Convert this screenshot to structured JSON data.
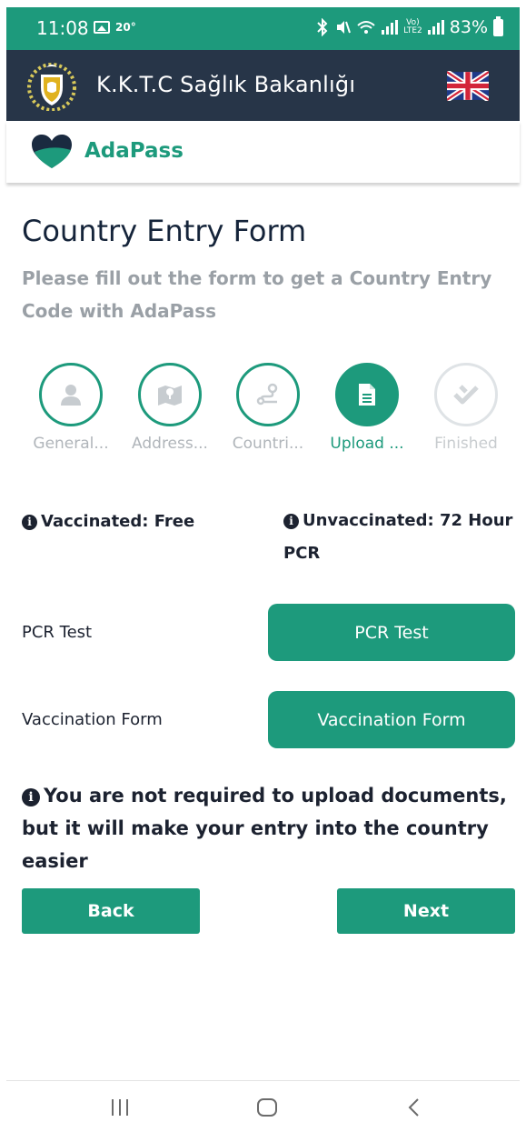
{
  "status_bar": {
    "time": "11:08",
    "temperature": "20°",
    "battery": "83%"
  },
  "header": {
    "title": "K.K.T.C Sağlık Bakanlığı",
    "emblem_icon": "kktc-emblem-icon",
    "language_icon": "uk-flag-icon"
  },
  "brand": {
    "name": "AdaPass",
    "logo_icon": "heart-logo-icon"
  },
  "page": {
    "title": "Country Entry Form",
    "subtitle": "Please fill out the form to get a Country Entry Code with AdaPass"
  },
  "steps": [
    {
      "label": "General...",
      "icon": "user-icon",
      "state": "complete"
    },
    {
      "label": "Address...",
      "icon": "map-icon",
      "state": "complete"
    },
    {
      "label": "Countri...",
      "icon": "route-icon",
      "state": "complete"
    },
    {
      "label": "Upload ...",
      "icon": "document-icon",
      "state": "active"
    },
    {
      "label": "Finished",
      "icon": "check-icon",
      "state": "pending"
    }
  ],
  "notes": {
    "vaccinated": "Vaccinated: Free",
    "unvaccinated": "Unvaccinated: 72 Hour PCR"
  },
  "uploads": [
    {
      "label": "PCR Test",
      "button": "PCR Test"
    },
    {
      "label": "Vaccination Form",
      "button": "Vaccination Form"
    }
  ],
  "notice": "You are not required to upload documents, but it will make your entry into the country easier",
  "actions": {
    "back": "Back",
    "next": "Next"
  },
  "colors": {
    "primary": "#1d9a7c",
    "header_bg": "#273548"
  }
}
